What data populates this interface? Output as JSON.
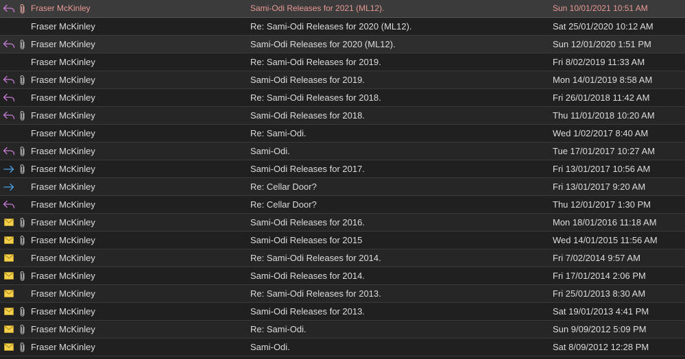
{
  "colors": {
    "reply": "#c77dd6",
    "forward": "#4aa3e8",
    "envelope": "#f3cf4a",
    "attachment": "#b8b8b8",
    "selected_text": "#e79a95"
  },
  "messages": [
    {
      "status_icon": "reply-icon",
      "attachment": true,
      "sender": "Fraser McKinley",
      "subject": "Sami-Odi Releases for 2021 (ML12).",
      "date": "Sun 10/01/2021 10:51 AM",
      "selected": true
    },
    {
      "status_icon": "none",
      "attachment": false,
      "sender": "Fraser McKinley",
      "subject": "Re: Sami-Odi Releases for 2020 (ML12).",
      "date": "Sat 25/01/2020 10:12 AM"
    },
    {
      "status_icon": "reply-icon",
      "attachment": true,
      "sender": "Fraser McKinley",
      "subject": "Sami-Odi Releases for 2020 (ML12).",
      "date": "Sun 12/01/2020 1:51 PM",
      "hovered": true
    },
    {
      "status_icon": "none",
      "attachment": false,
      "sender": "Fraser McKinley",
      "subject": "Re: Sami-Odi Releases for 2019.",
      "date": "Fri 8/02/2019 11:33 AM"
    },
    {
      "status_icon": "reply-icon",
      "attachment": true,
      "sender": "Fraser McKinley",
      "subject": "Sami-Odi Releases for 2019.",
      "date": "Mon 14/01/2019 8:58 AM"
    },
    {
      "status_icon": "reply-icon",
      "attachment": false,
      "sender": "Fraser McKinley",
      "subject": "Re: Sami-Odi Releases for 2018.",
      "date": "Fri 26/01/2018 11:42 AM"
    },
    {
      "status_icon": "reply-icon",
      "attachment": true,
      "sender": "Fraser McKinley",
      "subject": "Sami-Odi Releases for 2018.",
      "date": "Thu 11/01/2018 10:20 AM"
    },
    {
      "status_icon": "none",
      "attachment": false,
      "sender": "Fraser McKinley",
      "subject": "Re: Sami-Odi.",
      "date": "Wed 1/02/2017 8:40 AM"
    },
    {
      "status_icon": "reply-icon",
      "attachment": true,
      "sender": "Fraser McKinley",
      "subject": "Sami-Odi.",
      "date": "Tue 17/01/2017 10:27 AM"
    },
    {
      "status_icon": "forward-icon",
      "attachment": true,
      "sender": "Fraser McKinley",
      "subject": "Sami-Odi Releases for 2017.",
      "date": "Fri 13/01/2017 10:56 AM"
    },
    {
      "status_icon": "forward-icon",
      "attachment": false,
      "sender": "Fraser McKinley",
      "subject": "Re: Cellar Door?",
      "date": "Fri 13/01/2017 9:20 AM"
    },
    {
      "status_icon": "reply-icon",
      "attachment": false,
      "sender": "Fraser McKinley",
      "subject": "Re: Cellar Door?",
      "date": "Thu 12/01/2017 1:30 PM"
    },
    {
      "status_icon": "envelope-icon",
      "attachment": true,
      "sender": "Fraser McKinley",
      "subject": "Sami-Odi Releases for 2016.",
      "date": "Mon 18/01/2016 11:18 AM"
    },
    {
      "status_icon": "envelope-icon",
      "attachment": true,
      "sender": "Fraser McKinley",
      "subject": "Sami-Odi Releases for 2015",
      "date": "Wed 14/01/2015 11:56 AM"
    },
    {
      "status_icon": "envelope-icon",
      "attachment": false,
      "sender": "Fraser McKinley",
      "subject": "Re: Sami-Odi Releases for 2014.",
      "date": "Fri 7/02/2014 9:57 AM"
    },
    {
      "status_icon": "envelope-icon",
      "attachment": true,
      "sender": "Fraser McKinley",
      "subject": "Sami-Odi Releases for 2014.",
      "date": "Fri 17/01/2014 2:06 PM"
    },
    {
      "status_icon": "envelope-icon",
      "attachment": false,
      "sender": "Fraser McKinley",
      "subject": "Re: Sami-Odi Releases for 2013.",
      "date": "Fri 25/01/2013 8:30 AM"
    },
    {
      "status_icon": "envelope-icon",
      "attachment": true,
      "sender": "Fraser McKinley",
      "subject": "Sami-Odi Releases for 2013.",
      "date": "Sat 19/01/2013 4:41 PM"
    },
    {
      "status_icon": "envelope-icon",
      "attachment": true,
      "sender": "Fraser McKinley",
      "subject": "Re: Sami-Odi.",
      "date": "Sun 9/09/2012 5:09 PM"
    },
    {
      "status_icon": "envelope-icon",
      "attachment": true,
      "sender": "Fraser McKinley",
      "subject": "Sami-Odi.",
      "date": "Sat 8/09/2012 12:28 PM"
    }
  ]
}
